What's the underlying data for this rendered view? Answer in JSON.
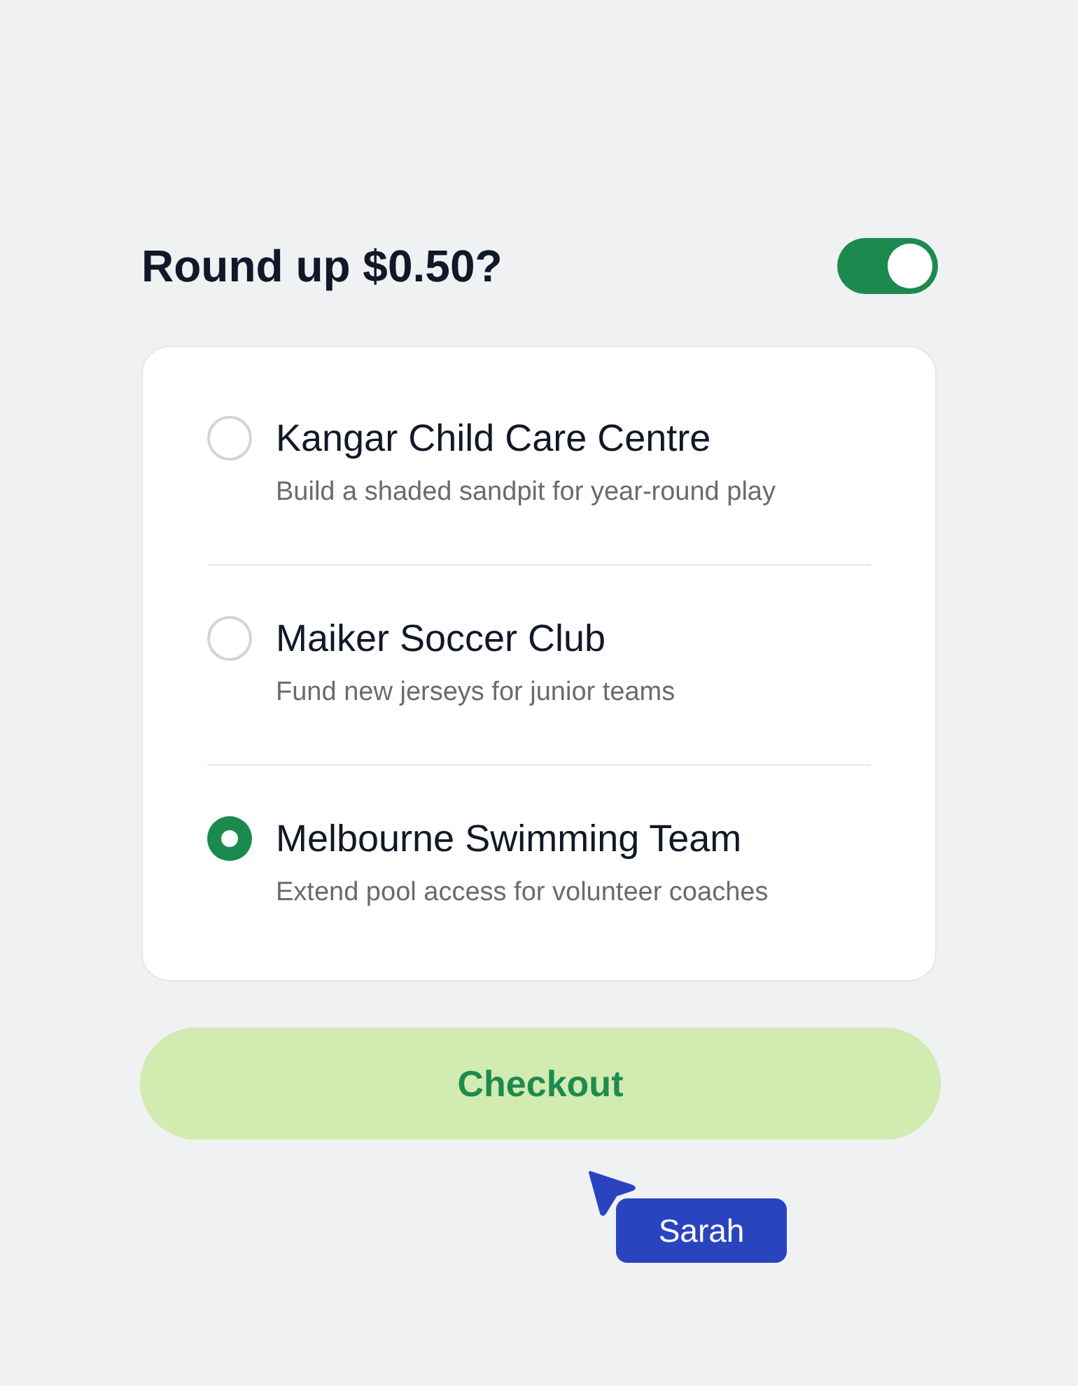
{
  "header": {
    "title": "Round up $0.50?",
    "toggle": {
      "on": true
    }
  },
  "options": [
    {
      "title": "Kangar Child Care Centre",
      "description": "Build a shaded sandpit for year-round play",
      "selected": false
    },
    {
      "title": "Maiker Soccer Club",
      "description": "Fund new jerseys for junior teams",
      "selected": false
    },
    {
      "title": "Melbourne Swimming Team",
      "description": "Extend pool access for volunteer coaches",
      "selected": true
    }
  ],
  "checkout_button": {
    "label": "Checkout"
  },
  "cursor": {
    "name": "Sarah"
  }
}
